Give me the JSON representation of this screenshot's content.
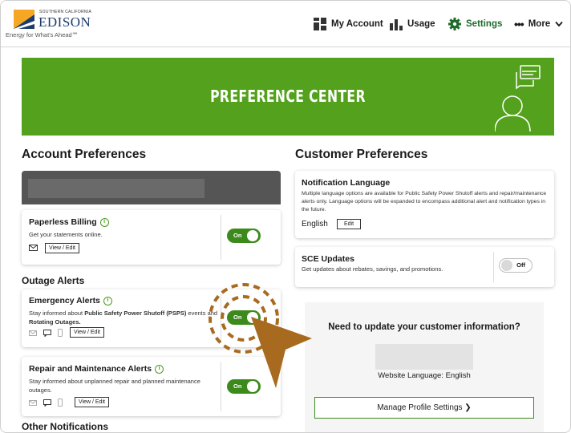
{
  "header": {
    "logo_small": "SOUTHERN CALIFORNIA",
    "logo_name": "EDISON",
    "logo_tagline": "Energy for What's Ahead℠",
    "nav": [
      {
        "label": "My Account",
        "icon": "account-grid-icon"
      },
      {
        "label": "Usage",
        "icon": "bar-chart-icon"
      },
      {
        "label": "Settings",
        "icon": "gear-icon",
        "active": true
      },
      {
        "label": "More",
        "icon": "ellipsis-icon"
      }
    ]
  },
  "banner": {
    "title": "PREFERENCE CENTER",
    "color": "#53a11c"
  },
  "account_preferences": {
    "heading": "Account Preferences",
    "paperless": {
      "title": "Paperless Billing",
      "description": "Get your statements online.",
      "button": "View / Edit",
      "toggle": "On"
    }
  },
  "outage_alerts": {
    "heading": "Outage Alerts",
    "emergency": {
      "title": "Emergency Alerts",
      "text_before": "Stay informed about ",
      "text_bold": "Public Safety Power Shutoff (PSPS)",
      "text_after": " events and",
      "text_bold2": "Rotating Outages.",
      "button": "View / Edit",
      "toggle": "On"
    },
    "repair": {
      "title": "Repair and Maintenance Alerts",
      "description": "Stay informed about unplanned repair and planned maintenance outages.",
      "button": "View / Edit",
      "toggle": "On"
    }
  },
  "other_notifications": {
    "heading": "Other Notifications"
  },
  "customer_preferences": {
    "heading": "Customer Preferences",
    "language": {
      "title": "Notification Language",
      "description": "Multiple language options are available for Public Safety Power Shutoff alerts and repair/maintenance alerts only. Language options will be expanded to encompass additional alert and notification types in the future.",
      "value": "English",
      "button": "Edit"
    },
    "sce_updates": {
      "title": "SCE Updates",
      "description": "Get updates about rebates, savings, and promotions.",
      "toggle": "Off"
    }
  },
  "update_panel": {
    "heading": "Need to update your customer information?",
    "website_language": "Website Language: English",
    "button": "Manage Profile Settings ❯"
  },
  "colors": {
    "accent_green": "#3d8a1c",
    "settings_green": "#1d6b2a",
    "pointer_brown": "#a86a1e"
  }
}
